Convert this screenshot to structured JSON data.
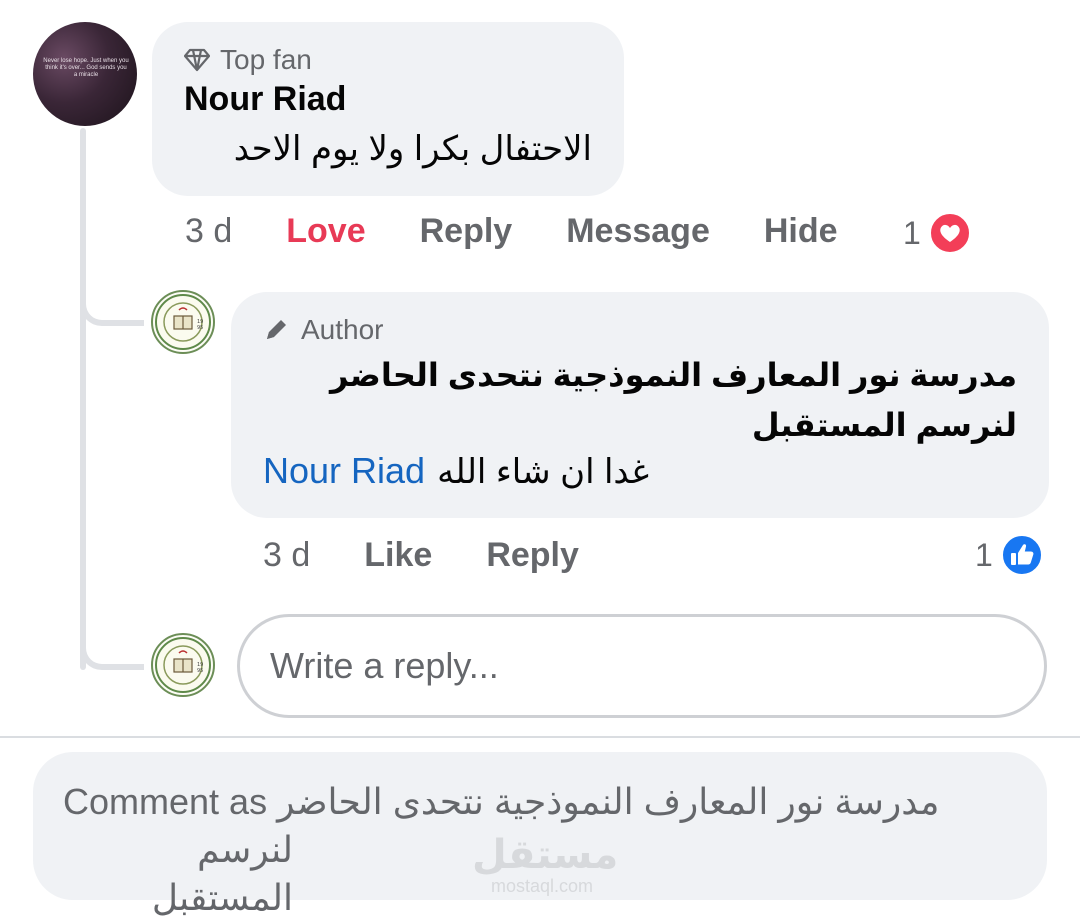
{
  "comment": {
    "badge": "Top fan",
    "author": "Nour Riad",
    "text": "الاحتفال بكرا ولا يوم الاحد",
    "avatar_quote": "Never lose hope. Just when you think it's over... God sends you a miracle",
    "time": "3 d",
    "actions": {
      "love": "Love",
      "reply": "Reply",
      "message": "Message",
      "hide": "Hide"
    },
    "reaction_count": "1",
    "reaction_icon": "heart-icon",
    "reaction_color": "#f33e58"
  },
  "reply": {
    "badge": "Author",
    "author": "مدرسة نور المعارف النموذجية نتحدى الحاضر لنرسم المستقبل",
    "mention": "Nour Riad",
    "text": "غدا ان شاء الله",
    "time": "3 d",
    "actions": {
      "like": "Like",
      "reply": "Reply"
    },
    "reaction_count": "1",
    "reaction_icon": "thumbs-up-icon",
    "reaction_color": "#1877f2"
  },
  "write_reply": {
    "placeholder": "Write a reply..."
  },
  "comment_as": {
    "prefix": "Comment as",
    "page_name": "مدرسة نور المعارف النموذجية نتحدى الحاضر",
    "page_name_line2": "لنرسم المستقبل"
  },
  "watermark": {
    "arabic": "مستقل",
    "latin": "mostaql.com"
  },
  "colors": {
    "love": "#e83a56",
    "mention": "#1565c0",
    "bubble": "#f0f2f5",
    "muted": "#65676b"
  }
}
